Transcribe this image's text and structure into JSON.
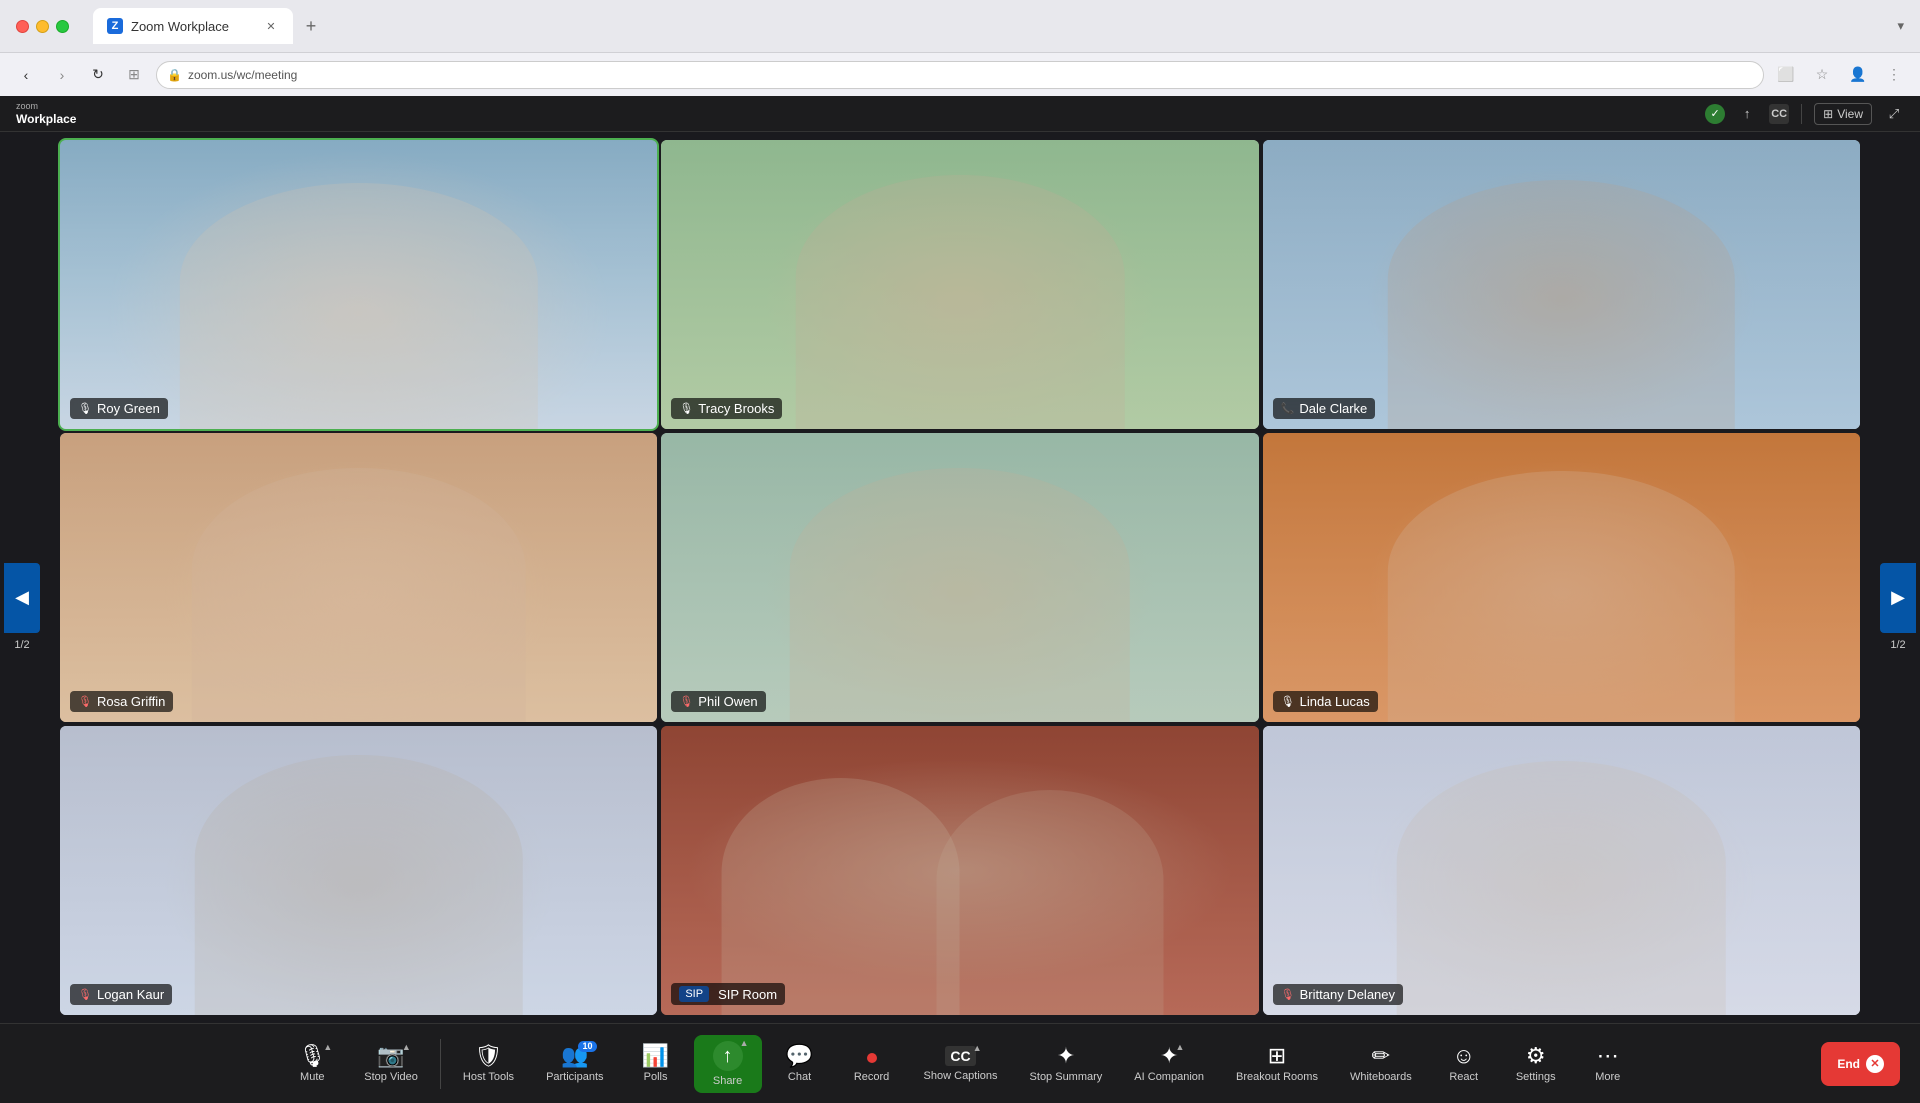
{
  "browser": {
    "tab_label": "Zoom Workplace",
    "tab_favicon": "Z",
    "close_icon": "✕",
    "new_tab_icon": "+",
    "nav_back": "‹",
    "nav_forward": "›",
    "nav_refresh": "↻",
    "nav_extensions": "⊞",
    "address_bar_text": "",
    "bookmark_icon": "☆",
    "profile_icon": "👤",
    "menu_icon": "⋮",
    "save_tab_icon": "⬜",
    "download_icon": "⬇"
  },
  "zoom_header": {
    "logo_top": "zoom",
    "logo_bottom": "Workplace",
    "shield_icon": "🛡",
    "wifi_icon": "↑",
    "captions_icon": "CC",
    "view_label": "View",
    "grid_icon": "⊞",
    "lock_icon": "🔒"
  },
  "participants": [
    {
      "name": "Roy Green",
      "mic": "active",
      "position": "top-left",
      "active_speaker": true
    },
    {
      "name": "Tracy Brooks",
      "mic": "active",
      "position": "top-center",
      "active_speaker": false
    },
    {
      "name": "Dale Clarke",
      "mic": "phone",
      "position": "top-right",
      "active_speaker": false
    },
    {
      "name": "Rosa Griffin",
      "mic": "muted",
      "position": "mid-left",
      "active_speaker": false
    },
    {
      "name": "Phil Owen",
      "mic": "muted",
      "position": "mid-center",
      "active_speaker": false
    },
    {
      "name": "Linda Lucas",
      "mic": "active",
      "position": "mid-right",
      "active_speaker": false
    },
    {
      "name": "Logan Kaur",
      "mic": "muted",
      "position": "bot-left",
      "active_speaker": false
    },
    {
      "name": "SIP Room",
      "mic": "sip",
      "position": "bot-center",
      "active_speaker": false
    },
    {
      "name": "Brittany Delaney",
      "mic": "muted",
      "position": "bot-right",
      "active_speaker": false
    }
  ],
  "navigation": {
    "left_arrow": "◀",
    "right_arrow": "▶",
    "page_indicator": "1/2"
  },
  "toolbar": {
    "mute_label": "Mute",
    "mute_icon": "🎙",
    "stop_video_label": "Stop Video",
    "stop_video_icon": "📷",
    "host_tools_label": "Host Tools",
    "host_tools_icon": "🛡",
    "participants_label": "Participants",
    "participants_icon": "👥",
    "participants_count": "10",
    "polls_label": "Polls",
    "polls_icon": "📊",
    "share_label": "Share",
    "share_icon": "↑",
    "chat_label": "Chat",
    "chat_icon": "💬",
    "record_label": "Record",
    "record_icon": "⏺",
    "show_captions_label": "Show Captions",
    "show_captions_icon": "CC",
    "stop_summary_label": "Stop Summary",
    "stop_summary_icon": "✦",
    "ai_companion_label": "AI Companion",
    "ai_companion_icon": "✦",
    "breakout_rooms_label": "Breakout Rooms",
    "breakout_rooms_icon": "⊞",
    "whiteboards_label": "Whiteboards",
    "whiteboards_icon": "✏",
    "react_label": "React",
    "react_icon": "☺",
    "settings_label": "Settings",
    "settings_icon": "⚙",
    "more_label": "More",
    "more_icon": "⋯",
    "end_label": "End"
  }
}
